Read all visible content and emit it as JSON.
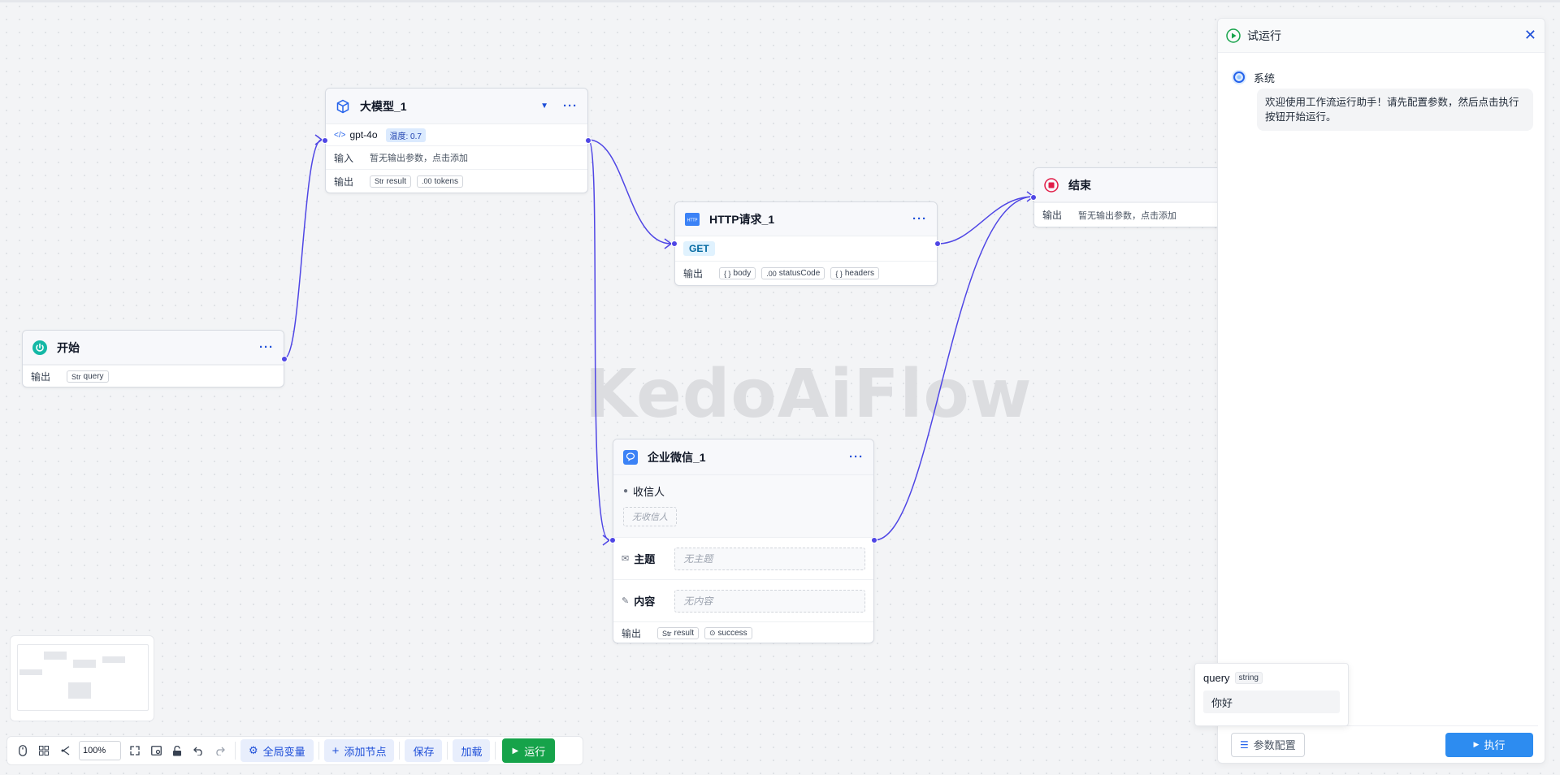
{
  "watermark": "KedoAiFlow",
  "nodes": {
    "start": {
      "title": "开始",
      "output_label": "输出",
      "outputs": [
        {
          "type": "Str",
          "name": "query"
        }
      ]
    },
    "llm": {
      "title": "大模型_1",
      "model": "gpt-4o",
      "temperature": "温度: 0.7",
      "input_label": "输入",
      "input_text": "暂无输出参数，点击添加",
      "output_label": "输出",
      "outputs": [
        {
          "type": "Str",
          "name": "result"
        },
        {
          "type": ".00",
          "name": "tokens"
        }
      ]
    },
    "http": {
      "title": "HTTP请求_1",
      "method": "GET",
      "output_label": "输出",
      "outputs": [
        {
          "type": "{ }",
          "name": "body"
        },
        {
          "type": ".00",
          "name": "statusCode"
        },
        {
          "type": "{ }",
          "name": "headers"
        }
      ]
    },
    "end": {
      "title": "结束",
      "output_label": "输出",
      "output_text": "暂无输出参数，点击添加"
    },
    "wecom": {
      "title": "企业微信_1",
      "recipient_label": "收信人",
      "recipient_placeholder": "无收信人",
      "subject_label": "主题",
      "subject_placeholder": "无主题",
      "content_label": "内容",
      "content_placeholder": "无内容",
      "output_label": "输出",
      "outputs": [
        {
          "type": "Str",
          "name": "result"
        },
        {
          "type": "⊙",
          "name": "success"
        }
      ]
    }
  },
  "panel": {
    "title": "试运行",
    "sender": "系统",
    "message": "欢迎使用工作流运行助手！请先配置参数，然后点击执行按钮开始运行。",
    "config_button": "参数配置",
    "execute_button": "执行"
  },
  "query_popup": {
    "label": "query",
    "type": "string",
    "value": "你好"
  },
  "toolbar": {
    "zoom": "100%",
    "global_vars": "全局变量",
    "add_node": "添加节点",
    "save": "保存",
    "load": "加载",
    "run": "运行"
  },
  "colors": {
    "accent": "#4f46e5",
    "run_green": "#16a34a",
    "execute_blue": "#2d8cf0",
    "start_teal": "#14b8a6",
    "end_red": "#e11d48"
  }
}
